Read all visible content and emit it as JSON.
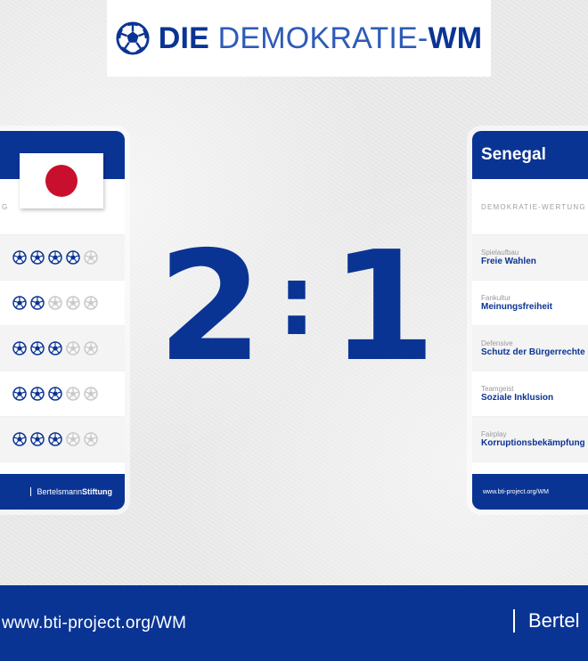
{
  "header": {
    "logo_bold_1": "DIE",
    "logo_light": "DEMOKRATIE-",
    "logo_bold_2": "WM"
  },
  "score": {
    "home": "2",
    "separator": ":",
    "away": "1"
  },
  "left_card": {
    "subtitle": "G",
    "ratings": [
      4,
      2,
      3,
      3,
      3
    ],
    "max_rating": 5,
    "footer_brand_light": "Bertelsmann",
    "footer_brand_bold": "Stiftung"
  },
  "right_card": {
    "country": "Senegal",
    "subtitle": "DEMOKRATIE-WERTUNG",
    "rows": [
      {
        "category": "Spielaufbau",
        "title": "Freie Wahlen"
      },
      {
        "category": "Fankultur",
        "title": "Meinungsfreiheit"
      },
      {
        "category": "Defensive",
        "title": "Schutz der Bürgerrechte"
      },
      {
        "category": "Teamgeist",
        "title": "Soziale Inklusion"
      },
      {
        "category": "Fairplay",
        "title": "Korruptionsbekämpfung"
      }
    ],
    "footer_url": "www.bti-project.org/WM"
  },
  "bottom_bar": {
    "url": "www.bti-project.org/WM",
    "brand": "Bertel"
  },
  "colors": {
    "brand_blue": "#0a3494",
    "flag_red": "#c8102e"
  },
  "icons": {
    "logo": "football-icon",
    "rating": "football-icon"
  }
}
